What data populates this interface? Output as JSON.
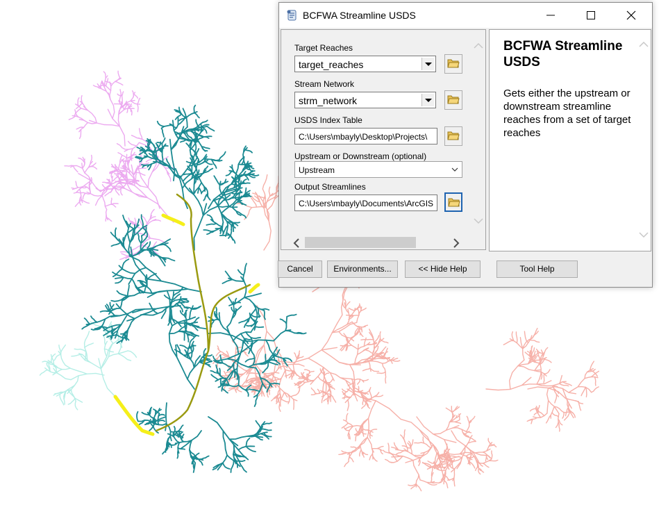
{
  "dialog": {
    "title": "BCFWA Streamline USDS",
    "icons": {
      "app": "script-tool-icon",
      "minimize": "minimize-icon",
      "maximize": "maximize-icon",
      "close": "close-icon"
    }
  },
  "params": {
    "target_reaches": {
      "label": "Target Reaches",
      "value": "target_reaches"
    },
    "stream_network": {
      "label": "Stream Network",
      "value": "strm_network"
    },
    "usds_index_table": {
      "label": "USDS Index Table",
      "value": "C:\\Users\\mbayly\\Desktop\\Projects\\"
    },
    "direction": {
      "label": "Upstream or Downstream (optional)",
      "value": "Upstream"
    },
    "output_streamlines": {
      "label": "Output Streamlines",
      "value": "C:\\Users\\mbayly\\Documents\\ArcGIS"
    }
  },
  "help": {
    "title": "BCFWA Streamline USDS",
    "body": "Gets either the upstream or downstream streamline reaches from a set of target reaches"
  },
  "buttons": {
    "cancel": "Cancel",
    "environments": "Environments...",
    "hide_help": "<< Hide Help",
    "tool_help": "Tool Help"
  },
  "map": {
    "colors": {
      "pink_network": "#ecaaf0",
      "teal_network": "#1b8a92",
      "salmon_network": "#f6b0a8",
      "mint_network": "#b5eee6",
      "highlight": "#f5ef1a",
      "main_stem": "#9a9a10"
    }
  }
}
